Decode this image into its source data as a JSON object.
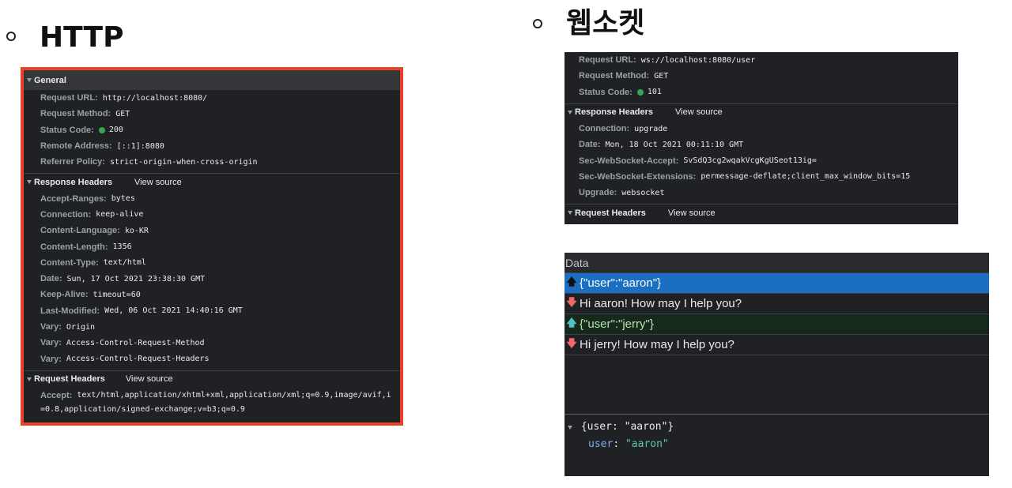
{
  "slide": {
    "left_title": "HTTP",
    "right_title": "웹소켓"
  },
  "http": {
    "general_label": "General",
    "general": [
      {
        "k": "Request URL:",
        "v": "http://localhost:8080/"
      },
      {
        "k": "Request Method:",
        "v": "GET"
      },
      {
        "k": "Status Code:",
        "v": "200"
      },
      {
        "k": "Remote Address:",
        "v": "[::1]:8080"
      },
      {
        "k": "Referrer Policy:",
        "v": "strict-origin-when-cross-origin"
      }
    ],
    "response_label": "Response Headers",
    "view_source": "View source",
    "response": [
      {
        "k": "Accept-Ranges:",
        "v": "bytes"
      },
      {
        "k": "Connection:",
        "v": "keep-alive"
      },
      {
        "k": "Content-Language:",
        "v": "ko-KR"
      },
      {
        "k": "Content-Length:",
        "v": "1356"
      },
      {
        "k": "Content-Type:",
        "v": "text/html"
      },
      {
        "k": "Date:",
        "v": "Sun, 17 Oct 2021 23:38:30 GMT"
      },
      {
        "k": "Keep-Alive:",
        "v": "timeout=60"
      },
      {
        "k": "Last-Modified:",
        "v": "Wed, 06 Oct 2021 14:40:16 GMT"
      },
      {
        "k": "Vary:",
        "v": "Origin"
      },
      {
        "k": "Vary:",
        "v": "Access-Control-Request-Method"
      },
      {
        "k": "Vary:",
        "v": "Access-Control-Request-Headers"
      }
    ],
    "request_label": "Request Headers",
    "request": [
      {
        "k": "Accept:",
        "v": "text/html,application/xhtml+xml,application/xml;q=0.9,image/avif,i"
      }
    ],
    "request_cont": "=0.8,application/signed-exchange;v=b3;q=0.9"
  },
  "ws": {
    "general": [
      {
        "k": "Request URL:",
        "v": "ws://localhost:8080/user"
      },
      {
        "k": "Request Method:",
        "v": "GET"
      },
      {
        "k": "Status Code:",
        "v": "101"
      }
    ],
    "response_label": "Response Headers",
    "view_source": "View source",
    "response": [
      {
        "k": "Connection:",
        "v": "upgrade"
      },
      {
        "k": "Date:",
        "v": "Mon, 18 Oct 2021 00:11:10 GMT"
      },
      {
        "k": "Sec-WebSocket-Accept:",
        "v": "SvSdQ3cg2wqakVcgKgUSeot13ig="
      },
      {
        "k": "Sec-WebSocket-Extensions:",
        "v": "permessage-deflate;client_max_window_bits=15"
      },
      {
        "k": "Upgrade:",
        "v": "websocket"
      }
    ],
    "request_label": "Request Headers"
  },
  "frames": {
    "header": "Data",
    "messages": [
      {
        "dir": "up",
        "text": "{\"user\":\"aaron\"}"
      },
      {
        "dir": "down",
        "text": "Hi aaron! How may I help you?"
      },
      {
        "dir": "up",
        "text": "{\"user\":\"jerry\"}"
      },
      {
        "dir": "down",
        "text": "Hi jerry! How may I help you?"
      }
    ],
    "detail_line1": "{user: \"aaron\"}",
    "detail_key": "user",
    "detail_value": "\"aaron\""
  },
  "colors": {
    "highlight_border": "#e8412a",
    "status_green": "#34a853",
    "selected_row": "#1a6fc2"
  }
}
